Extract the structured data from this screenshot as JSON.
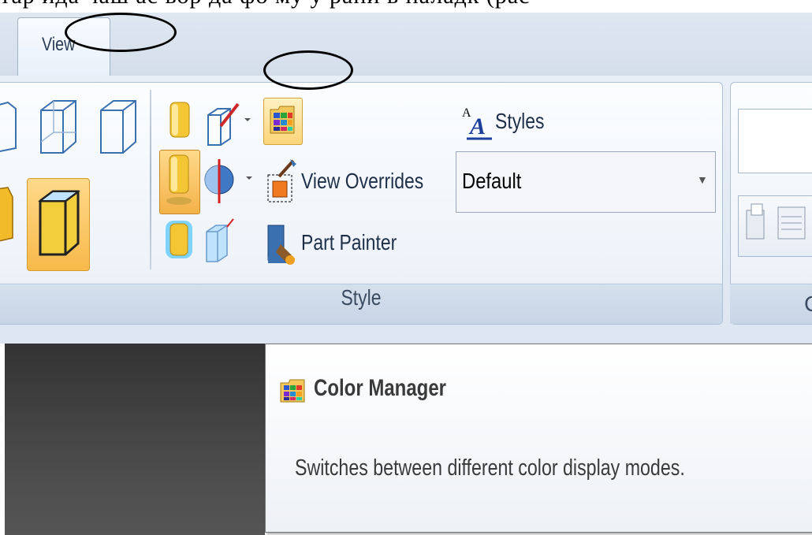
{
  "top_text": "тар ида чаш ас  вор да фо му у рани в наладк (рас",
  "ribbon": {
    "tab_view_label": "View",
    "style_group": {
      "label": "Style",
      "styles_label": "Styles",
      "view_overrides_label": "View Overrides",
      "part_painter_label": "Part Painter",
      "dropdown_value": "Default"
    },
    "next_group_label": "C"
  },
  "tooltip": {
    "title": "Color Manager",
    "description": "Switches between different color display modes."
  },
  "icons": [
    "box-wireframe-icon",
    "box-hidden-edges-icon",
    "box-visible-edges-icon",
    "shaded-icon",
    "shaded-visible-edges-icon",
    "shaded-highlight-icon",
    "transparency-icon",
    "color-manager-icon",
    "styles-icon",
    "view-overrides-icon",
    "part-painter-icon",
    "sphere-section-icon",
    "wand-icon"
  ],
  "colors": {
    "accent_orange": "#f7c25a",
    "ribbon_blue": "#d4deea"
  }
}
